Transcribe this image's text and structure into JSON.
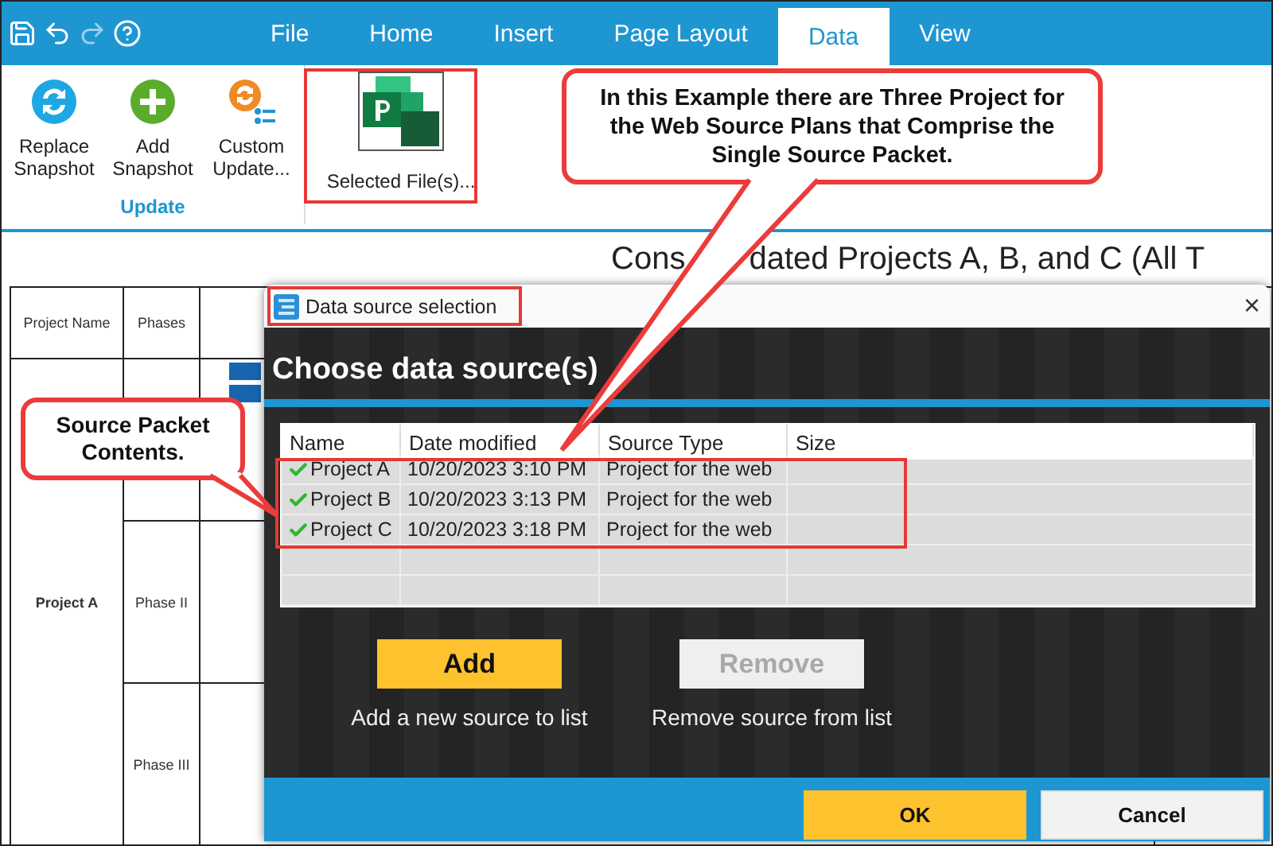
{
  "menu_tabs": [
    {
      "label": "File",
      "selected": false
    },
    {
      "label": "Home",
      "selected": false
    },
    {
      "label": "Insert",
      "selected": false
    },
    {
      "label": "Page Layout",
      "selected": false
    },
    {
      "label": "Data",
      "selected": true
    },
    {
      "label": "View",
      "selected": false
    }
  ],
  "ribbon": {
    "buttons": [
      {
        "label": "Replace Snapshot",
        "kind": "replace"
      },
      {
        "label": "Add Snapshot",
        "kind": "add"
      },
      {
        "label": "Custom Update...",
        "kind": "custom"
      }
    ],
    "group_label": "Update",
    "file_button": {
      "label": "Selected File(s)..."
    }
  },
  "document": {
    "title_parts": [
      "Cons",
      "dated Projects A, B, and C (All T"
    ],
    "columns": [
      "Project Name",
      "Phases"
    ],
    "project": "Project A",
    "phases": [
      "Phase II",
      "Phase III"
    ]
  },
  "dialog": {
    "title": "Data source selection",
    "close": "×",
    "heading": "Choose data source(s)",
    "columns": [
      "Name",
      "Date modified",
      "Source Type",
      "Size"
    ],
    "rows": [
      {
        "name": "Project A",
        "date": "10/20/2023 3:10 PM",
        "type": "Project for the web",
        "checked": true
      },
      {
        "name": "Project B",
        "date": "10/20/2023 3:13 PM",
        "type": "Project for the web",
        "checked": true
      },
      {
        "name": "Project C",
        "date": "10/20/2023 3:18 PM",
        "type": "Project for the web",
        "checked": true
      }
    ],
    "actions": [
      {
        "label": "Add",
        "caption": "Add a new source to list",
        "disabled": false
      },
      {
        "label": "Remove",
        "caption": "Remove source from list",
        "disabled": true
      }
    ],
    "footer_buttons": [
      {
        "label": "OK",
        "kind": "primary"
      },
      {
        "label": "Cancel",
        "kind": "secondary"
      }
    ]
  },
  "callouts": [
    {
      "text": "In this Example there are Three Project for the Web Source Plans that Comprise the Single Source Packet."
    },
    {
      "text": "Source Packet Contents."
    }
  ]
}
